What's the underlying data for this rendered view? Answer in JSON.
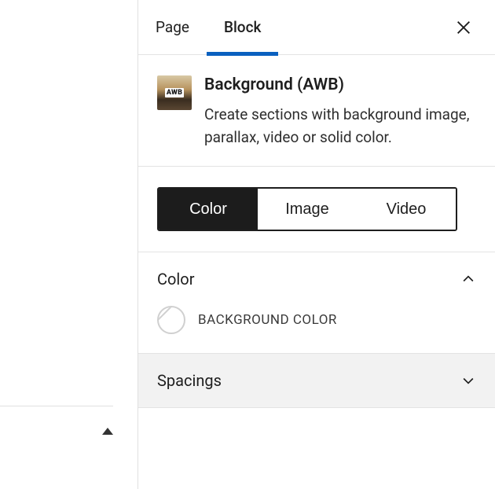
{
  "tabs": {
    "page": "Page",
    "block": "Block"
  },
  "block": {
    "iconBadge": "AWB",
    "title": "Background (AWB)",
    "description": "Create sections with background image, parallax, video or solid color."
  },
  "typeSwitch": {
    "color": "Color",
    "image": "Image",
    "video": "Video"
  },
  "sections": {
    "color": {
      "title": "Color",
      "swatchLabel": "BACKGROUND COLOR"
    },
    "spacings": {
      "title": "Spacings"
    }
  }
}
